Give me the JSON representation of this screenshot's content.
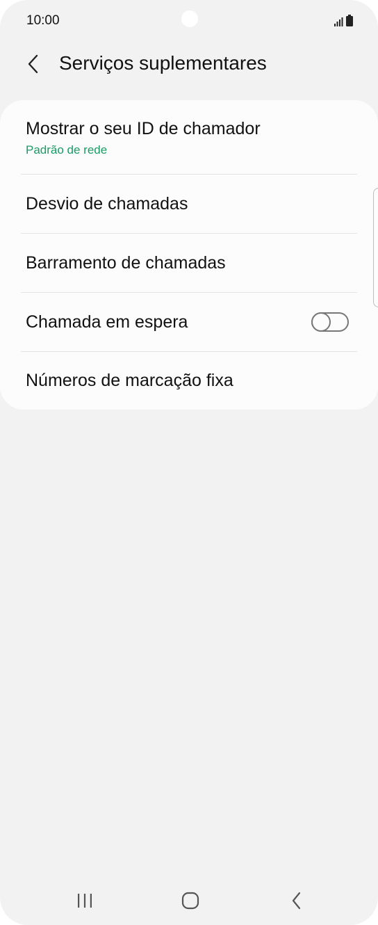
{
  "status_bar": {
    "time": "10:00",
    "icons": [
      "signal-icon",
      "battery-icon"
    ]
  },
  "header": {
    "back_icon": "chevron-left-icon",
    "title": "Serviços suplementares"
  },
  "settings": {
    "items": [
      {
        "title": "Mostrar o seu ID de chamador",
        "subtitle": "Padrão de rede"
      },
      {
        "title": "Desvio de chamadas"
      },
      {
        "title": "Barramento de chamadas"
      },
      {
        "title": "Chamada em espera",
        "toggle": "off"
      },
      {
        "title": "Números de marcação fixa"
      }
    ]
  },
  "navigation_bar": {
    "buttons": [
      "recent-apps-icon",
      "home-icon",
      "back-icon"
    ]
  },
  "colors": {
    "background": "#f2f2f2",
    "card": "#fcfcfc",
    "subtitle_accent": "#1b9b65",
    "text": "#111111"
  }
}
